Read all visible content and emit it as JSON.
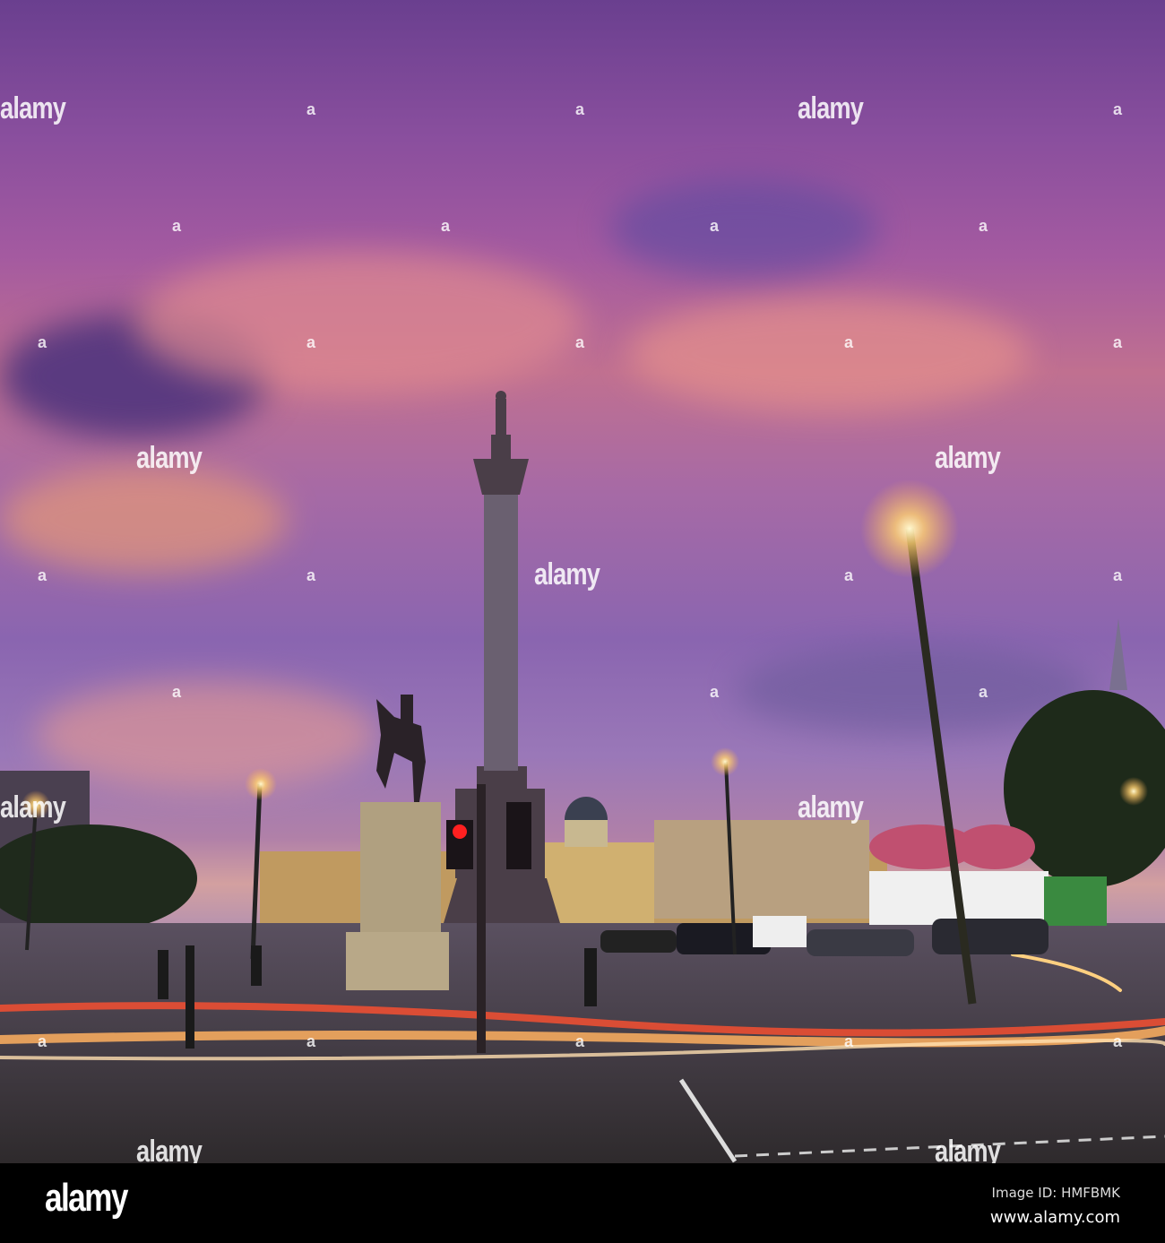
{
  "watermark": {
    "text": "alamy",
    "mark": "a"
  },
  "footer": {
    "logo": "alamy",
    "image_id": "Image ID: HMFBMK",
    "url": "www.alamy.com"
  }
}
